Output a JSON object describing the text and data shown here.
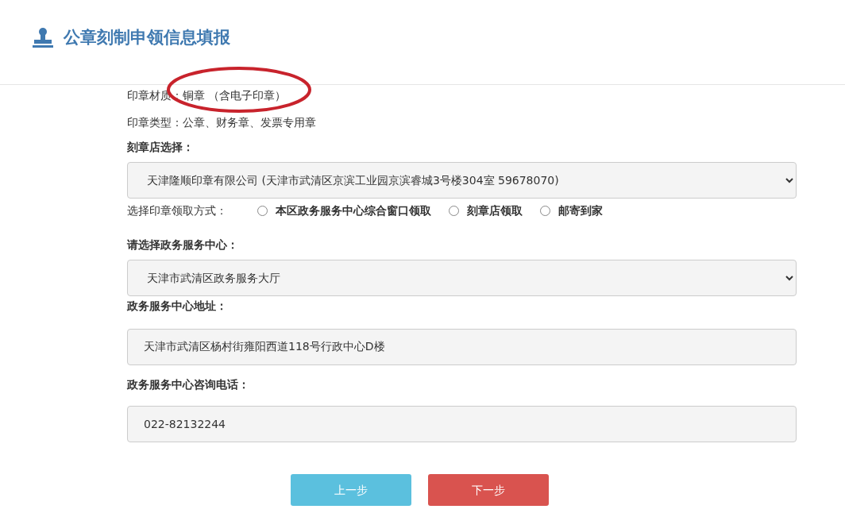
{
  "header": {
    "title": "公章刻制申领信息填报"
  },
  "info_rows": [
    {
      "label": "印章材质：",
      "value": "铜章 （含电子印章）"
    },
    {
      "label": "印章类型：",
      "value": "公章、财务章、发票专用章"
    }
  ],
  "annotation": {
    "kind": "ellipse",
    "color": "#c8232c"
  },
  "shop": {
    "label": "刻章店选择：",
    "value": "天津隆顺印章有限公司 (天津市武清区京滨工业园京滨睿城3号楼304室 59678070)"
  },
  "pickup": {
    "label": "选择印章领取方式：",
    "options": [
      {
        "label": "本区政务服务中心综合窗口领取",
        "selected": false
      },
      {
        "label": "刻章店领取",
        "selected": false
      },
      {
        "label": "邮寄到家",
        "selected": false
      }
    ]
  },
  "center": {
    "label": "请选择政务服务中心：",
    "value": "天津市武清区政务服务大厅"
  },
  "address": {
    "label": "政务服务中心地址：",
    "value": "天津市武清区杨村街雍阳西道118号行政中心D楼"
  },
  "phone": {
    "label": "政务服务中心咨询电话：",
    "value": "022-82132244"
  },
  "buttons": [
    {
      "label": "上一步",
      "kind": "prev"
    },
    {
      "label": "下一步",
      "kind": "next"
    }
  ]
}
